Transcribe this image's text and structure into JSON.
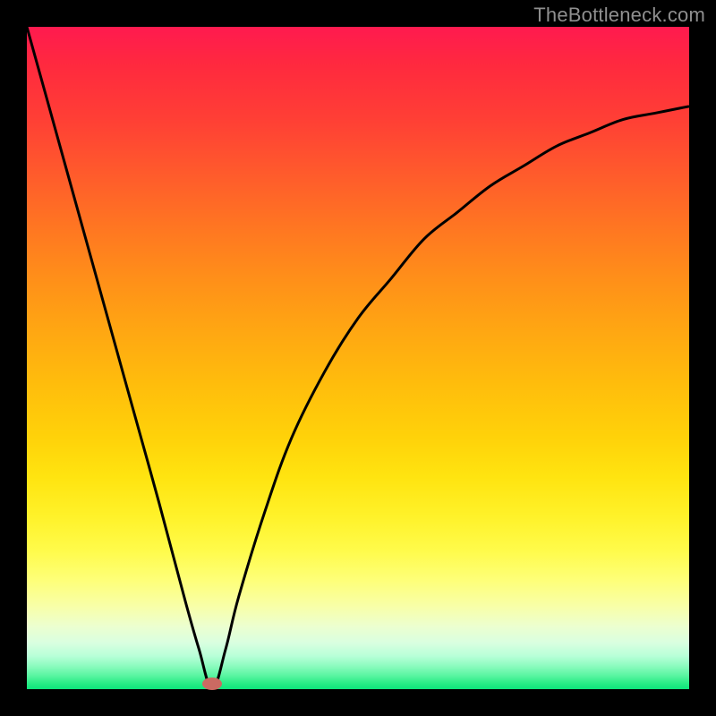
{
  "watermark": "TheBottleneck.com",
  "colors": {
    "frame": "#000000",
    "curve_stroke": "#000000",
    "marker_fill": "#cb6a62",
    "watermark_text": "#8f8f8f"
  },
  "chart_data": {
    "type": "line",
    "title": "",
    "xlabel": "",
    "ylabel": "",
    "xlim": [
      0,
      1
    ],
    "ylim": [
      0,
      1
    ],
    "curve": {
      "minimum_x": 0.28,
      "x": [
        0.0,
        0.05,
        0.1,
        0.15,
        0.2,
        0.24,
        0.26,
        0.28,
        0.3,
        0.32,
        0.36,
        0.4,
        0.45,
        0.5,
        0.55,
        0.6,
        0.65,
        0.7,
        0.75,
        0.8,
        0.85,
        0.9,
        0.95,
        1.0
      ],
      "y": [
        1.0,
        0.82,
        0.64,
        0.46,
        0.28,
        0.13,
        0.06,
        0.0,
        0.06,
        0.14,
        0.27,
        0.38,
        0.48,
        0.56,
        0.62,
        0.68,
        0.72,
        0.76,
        0.79,
        0.82,
        0.84,
        0.86,
        0.87,
        0.88
      ]
    },
    "marker": {
      "x": 0.28,
      "y": 0.0
    },
    "background_gradient": {
      "top": "#ff1a4f",
      "mid": "#ffd209",
      "bottom": "#0de47a"
    }
  }
}
